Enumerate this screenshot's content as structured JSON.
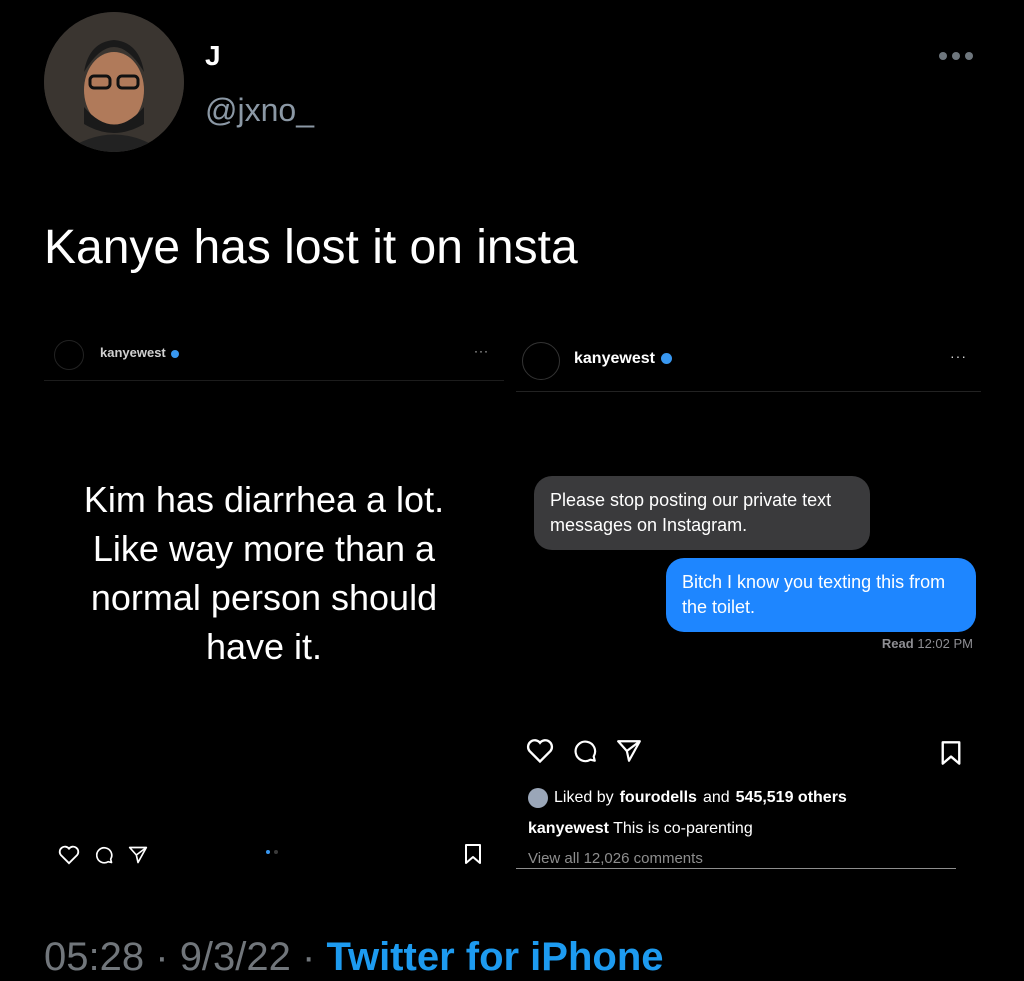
{
  "tweet": {
    "display_name": "J",
    "handle": "@jxno_",
    "text": "Kanye has lost it on insta",
    "time": "05:28",
    "date": "9/3/22",
    "separator": "·",
    "client": "Twitter for iPhone",
    "more_icon": "more-horizontal-icon"
  },
  "left_post": {
    "username": "kanyewest",
    "more_label": "···",
    "quote": "Kim has diarrhea a lot. Like way more than a normal person should have it.",
    "icons": [
      "heart-icon",
      "comment-icon",
      "share-icon",
      "bookmark-icon"
    ],
    "carousel_dots": 2
  },
  "right_post": {
    "username": "kanyewest",
    "more_label": "···",
    "message_in": "Please stop posting our private text messages on Instagram.",
    "message_out": "Bitch I know you texting this from the toilet.",
    "read_label": "Read",
    "read_time": "12:02 PM",
    "likes_prefix": "Liked by",
    "likes_user": "fourodells",
    "likes_and": "and",
    "likes_count": "545,519 others",
    "caption_user": "kanyewest",
    "caption_text": "This is co-parenting",
    "comments_link": "View all 12,026 comments",
    "icons": [
      "heart-icon",
      "comment-icon",
      "share-icon",
      "bookmark-icon"
    ]
  },
  "colors": {
    "background": "#000000",
    "link_blue": "#1d9bf0",
    "imessage_blue": "#1e86ff",
    "imessage_gray": "#3a3a3c",
    "muted_text": "#71767b"
  }
}
